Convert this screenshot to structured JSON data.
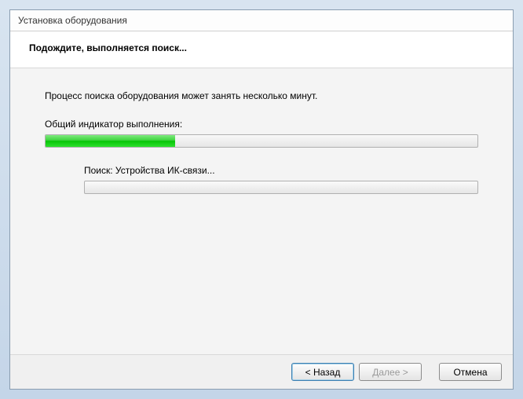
{
  "window": {
    "title": "Установка оборудования"
  },
  "header": {
    "title": "Подождите, выполняется поиск..."
  },
  "content": {
    "intro": "Процесс поиска оборудования может занять несколько минут.",
    "overall_label": "Общий индикатор выполнения:",
    "overall_percent": 30,
    "search_label": "Поиск: Устройства ИК-связи...",
    "search_percent": 0
  },
  "buttons": {
    "back": "< Назад",
    "next": "Далее >",
    "cancel": "Отмена"
  }
}
